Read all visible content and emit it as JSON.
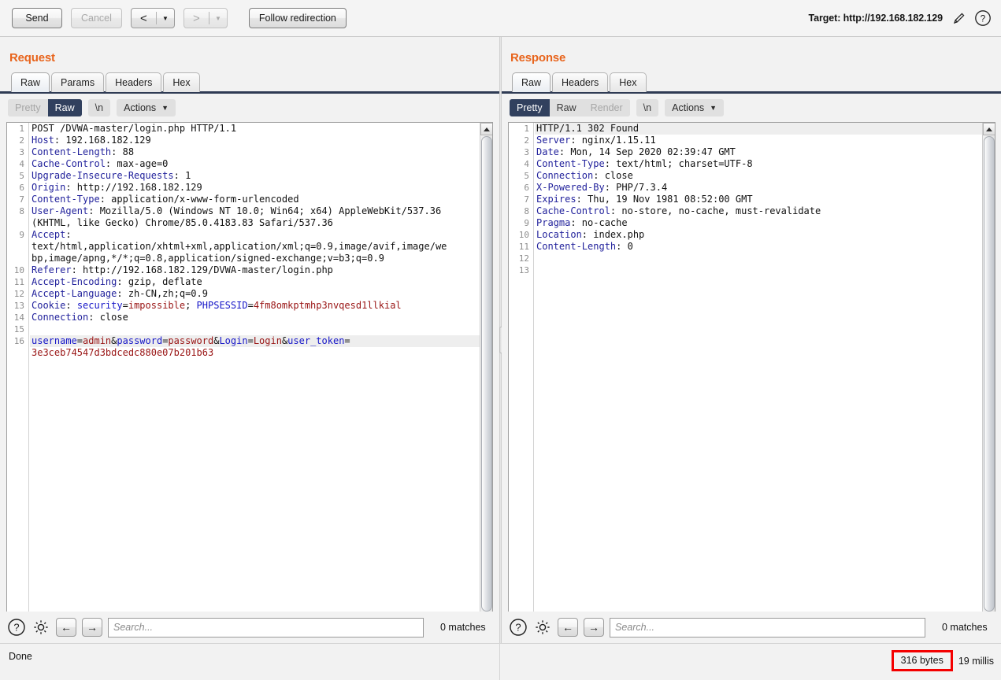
{
  "toolbar": {
    "send_label": "Send",
    "cancel_label": "Cancel",
    "back_glyph": "<",
    "forward_glyph": ">",
    "dropdown_glyph": "▼",
    "follow_redirection_label": "Follow redirection",
    "target_label": "Target: http://192.168.182.129",
    "edit_icon": "pencil-icon",
    "help_icon": "help-icon"
  },
  "layout": {
    "toggles": [
      {
        "name": "side-by-side",
        "selected": true
      },
      {
        "name": "stacked",
        "selected": false
      },
      {
        "name": "single-pane",
        "selected": false
      }
    ]
  },
  "request": {
    "title": "Request",
    "tabs": [
      {
        "label": "Raw",
        "active": true
      },
      {
        "label": "Params",
        "active": false
      },
      {
        "label": "Headers",
        "active": false
      },
      {
        "label": "Hex",
        "active": false
      }
    ],
    "view_modes": [
      {
        "label": "Pretty",
        "selected": false,
        "disabled": true
      },
      {
        "label": "Raw",
        "selected": true,
        "disabled": false
      }
    ],
    "newline_label": "\\n",
    "actions_label": "Actions",
    "lines": [
      {
        "n": "1",
        "hl": false,
        "parts": [
          {
            "t": "POST /DVWA-master/login.php HTTP/1.1",
            "c": "hv"
          }
        ]
      },
      {
        "n": "2",
        "hl": false,
        "parts": [
          {
            "t": "Host",
            "c": "hk"
          },
          {
            "t": ": 192.168.182.129",
            "c": "hv"
          }
        ]
      },
      {
        "n": "3",
        "hl": false,
        "parts": [
          {
            "t": "Content-Length",
            "c": "hk"
          },
          {
            "t": ": 88",
            "c": "hv"
          }
        ]
      },
      {
        "n": "4",
        "hl": false,
        "parts": [
          {
            "t": "Cache-Control",
            "c": "hk"
          },
          {
            "t": ": max-age=0",
            "c": "hv"
          }
        ]
      },
      {
        "n": "5",
        "hl": false,
        "parts": [
          {
            "t": "Upgrade-Insecure-Requests",
            "c": "hk"
          },
          {
            "t": ": 1",
            "c": "hv"
          }
        ]
      },
      {
        "n": "6",
        "hl": false,
        "parts": [
          {
            "t": "Origin",
            "c": "hk"
          },
          {
            "t": ": http://192.168.182.129",
            "c": "hv"
          }
        ]
      },
      {
        "n": "7",
        "hl": false,
        "parts": [
          {
            "t": "Content-Type",
            "c": "hk"
          },
          {
            "t": ": application/x-www-form-urlencoded",
            "c": "hv"
          }
        ]
      },
      {
        "n": "8",
        "hl": false,
        "parts": [
          {
            "t": "User-Agent",
            "c": "hk"
          },
          {
            "t": ": Mozilla/5.0 (Windows NT 10.0; Win64; x64) AppleWebKit/537.36",
            "c": "hv"
          }
        ]
      },
      {
        "n": "",
        "hl": false,
        "parts": [
          {
            "t": "(KHTML, like Gecko) Chrome/85.0.4183.83 Safari/537.36",
            "c": "hv"
          }
        ]
      },
      {
        "n": "9",
        "hl": false,
        "parts": [
          {
            "t": "Accept",
            "c": "hk"
          },
          {
            "t": ":",
            "c": "hv"
          }
        ]
      },
      {
        "n": "",
        "hl": false,
        "parts": [
          {
            "t": "text/html,application/xhtml+xml,application/xml;q=0.9,image/avif,image/we",
            "c": "hv"
          }
        ]
      },
      {
        "n": "",
        "hl": false,
        "parts": [
          {
            "t": "bp,image/apng,*/*;q=0.8,application/signed-exchange;v=b3;q=0.9",
            "c": "hv"
          }
        ]
      },
      {
        "n": "10",
        "hl": false,
        "parts": [
          {
            "t": "Referer",
            "c": "hk"
          },
          {
            "t": ": http://192.168.182.129/DVWA-master/login.php",
            "c": "hv"
          }
        ]
      },
      {
        "n": "11",
        "hl": false,
        "parts": [
          {
            "t": "Accept-Encoding",
            "c": "hk"
          },
          {
            "t": ": gzip, deflate",
            "c": "hv"
          }
        ]
      },
      {
        "n": "12",
        "hl": false,
        "parts": [
          {
            "t": "Accept-Language",
            "c": "hk"
          },
          {
            "t": ": zh-CN,zh;q=0.9",
            "c": "hv"
          }
        ]
      },
      {
        "n": "13",
        "hl": false,
        "parts": [
          {
            "t": "Cookie",
            "c": "hk"
          },
          {
            "t": ": ",
            "c": "hv"
          },
          {
            "t": "security",
            "c": "pk"
          },
          {
            "t": "=",
            "c": "amp"
          },
          {
            "t": "impossible",
            "c": "pv"
          },
          {
            "t": "; ",
            "c": "hv"
          },
          {
            "t": "PHPSESSID",
            "c": "pk"
          },
          {
            "t": "=",
            "c": "amp"
          },
          {
            "t": "4fm8omkptmhp3nvqesd1llkial",
            "c": "pv"
          }
        ]
      },
      {
        "n": "14",
        "hl": false,
        "parts": [
          {
            "t": "Connection",
            "c": "hk"
          },
          {
            "t": ": close",
            "c": "hv"
          }
        ]
      },
      {
        "n": "15",
        "hl": false,
        "parts": [
          {
            "t": "",
            "c": "hv"
          }
        ]
      },
      {
        "n": "16",
        "hl": true,
        "parts": [
          {
            "t": "username",
            "c": "pk"
          },
          {
            "t": "=",
            "c": "amp"
          },
          {
            "t": "admin",
            "c": "pv"
          },
          {
            "t": "&",
            "c": "amp"
          },
          {
            "t": "password",
            "c": "pk"
          },
          {
            "t": "=",
            "c": "amp"
          },
          {
            "t": "password",
            "c": "pv"
          },
          {
            "t": "&",
            "c": "amp"
          },
          {
            "t": "Login",
            "c": "pk"
          },
          {
            "t": "=",
            "c": "amp"
          },
          {
            "t": "Login",
            "c": "pv"
          },
          {
            "t": "&",
            "c": "amp"
          },
          {
            "t": "user_token",
            "c": "pk"
          },
          {
            "t": "=",
            "c": "amp"
          }
        ]
      },
      {
        "n": "",
        "hl": false,
        "parts": [
          {
            "t": "3e3ceb74547d3bdcedc880e07b201b63",
            "c": "pv"
          }
        ]
      }
    ],
    "search": {
      "placeholder": "Search...",
      "value": "",
      "matches": "0 matches",
      "help_icon": "help-icon",
      "settings_icon": "gear-icon",
      "prev_glyph": "←",
      "next_glyph": "→"
    }
  },
  "response": {
    "title": "Response",
    "tabs": [
      {
        "label": "Raw",
        "active": true
      },
      {
        "label": "Headers",
        "active": false
      },
      {
        "label": "Hex",
        "active": false
      }
    ],
    "view_modes": [
      {
        "label": "Pretty",
        "selected": true,
        "disabled": false
      },
      {
        "label": "Raw",
        "selected": false,
        "disabled": false
      },
      {
        "label": "Render",
        "selected": false,
        "disabled": true
      }
    ],
    "newline_label": "\\n",
    "actions_label": "Actions",
    "lines": [
      {
        "n": "1",
        "hl": true,
        "parts": [
          {
            "t": "HTTP/1.1 302 Found",
            "c": "hv"
          }
        ]
      },
      {
        "n": "2",
        "hl": false,
        "parts": [
          {
            "t": "Server",
            "c": "hk"
          },
          {
            "t": ": nginx/1.15.11",
            "c": "hv"
          }
        ]
      },
      {
        "n": "3",
        "hl": false,
        "parts": [
          {
            "t": "Date",
            "c": "hk"
          },
          {
            "t": ": Mon, 14 Sep 2020 02:39:47 GMT",
            "c": "hv"
          }
        ]
      },
      {
        "n": "4",
        "hl": false,
        "parts": [
          {
            "t": "Content-Type",
            "c": "hk"
          },
          {
            "t": ": text/html; charset=UTF-8",
            "c": "hv"
          }
        ]
      },
      {
        "n": "5",
        "hl": false,
        "parts": [
          {
            "t": "Connection",
            "c": "hk"
          },
          {
            "t": ": close",
            "c": "hv"
          }
        ]
      },
      {
        "n": "6",
        "hl": false,
        "parts": [
          {
            "t": "X-Powered-By",
            "c": "hk"
          },
          {
            "t": ": PHP/7.3.4",
            "c": "hv"
          }
        ]
      },
      {
        "n": "7",
        "hl": false,
        "parts": [
          {
            "t": "Expires",
            "c": "hk"
          },
          {
            "t": ": Thu, 19 Nov 1981 08:52:00 GMT",
            "c": "hv"
          }
        ]
      },
      {
        "n": "8",
        "hl": false,
        "parts": [
          {
            "t": "Cache-Control",
            "c": "hk"
          },
          {
            "t": ": no-store, no-cache, must-revalidate",
            "c": "hv"
          }
        ]
      },
      {
        "n": "9",
        "hl": false,
        "parts": [
          {
            "t": "Pragma",
            "c": "hk"
          },
          {
            "t": ": no-cache",
            "c": "hv"
          }
        ]
      },
      {
        "n": "10",
        "hl": false,
        "parts": [
          {
            "t": "Location",
            "c": "hk"
          },
          {
            "t": ": index.php",
            "c": "hv"
          }
        ]
      },
      {
        "n": "11",
        "hl": false,
        "parts": [
          {
            "t": "Content-Length",
            "c": "hk"
          },
          {
            "t": ": 0",
            "c": "hv"
          }
        ]
      },
      {
        "n": "12",
        "hl": false,
        "parts": [
          {
            "t": "",
            "c": "hv"
          }
        ]
      },
      {
        "n": "13",
        "hl": false,
        "parts": [
          {
            "t": "",
            "c": "hv"
          }
        ]
      }
    ],
    "search": {
      "placeholder": "Search...",
      "value": "",
      "matches": "0 matches",
      "help_icon": "help-icon",
      "settings_icon": "gear-icon",
      "prev_glyph": "←",
      "next_glyph": "→"
    }
  },
  "status": {
    "message": "Done",
    "bytes": "316 bytes",
    "millis": "19 millis"
  },
  "colors": {
    "accent_orange": "#e8641c",
    "selected_navy": "#31405e",
    "header_key_blue": "#22229c",
    "param_key_blue": "#1616c8",
    "param_value_red": "#991414",
    "annotation_red": "#f40000"
  }
}
